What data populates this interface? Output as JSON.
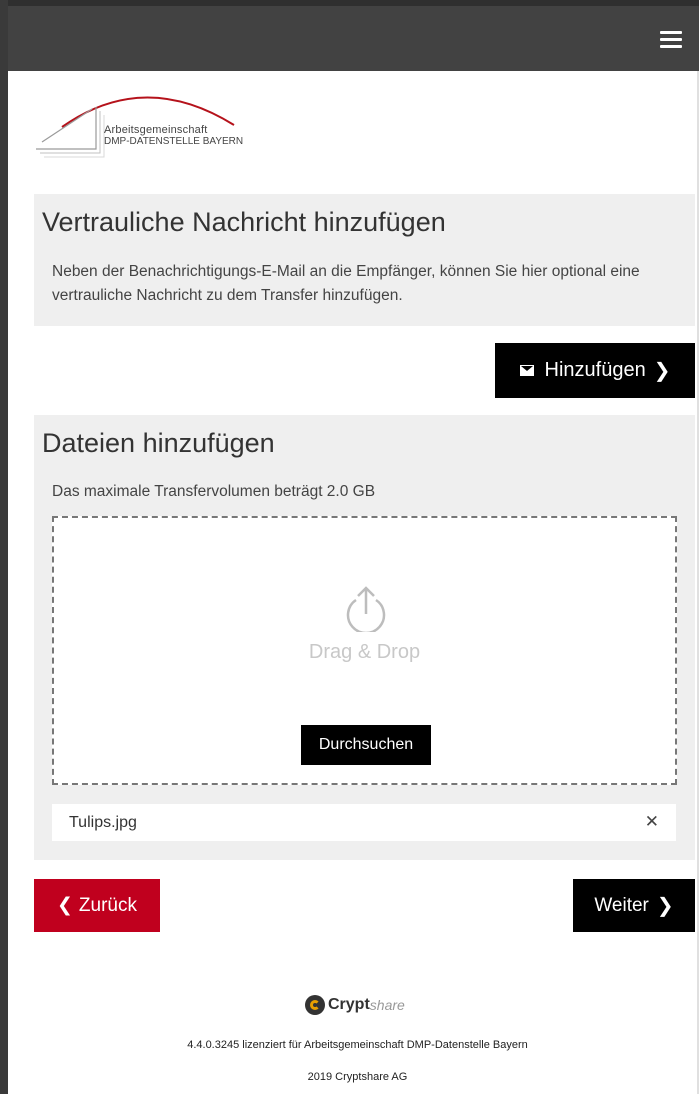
{
  "header": {
    "menu_icon": "hamburger-menu-icon"
  },
  "logo": {
    "line1": "Arbeitsgemeinschaft",
    "line2": "DMP-DATENSTELLE BAYERN",
    "accent_color": "#b5121b"
  },
  "message_section": {
    "title": "Vertrauliche Nachricht hinzufügen",
    "description": "Neben der Benachrichtigungs-E-Mail an die Empfänger, können Sie hier optional eine vertrauliche Nachricht zu dem Transfer hinzufügen.",
    "add_button_label": "Hinzufügen"
  },
  "files_section": {
    "title": "Dateien hinzufügen",
    "limit_text": "Das maximale Transfervolumen beträgt 2.0 GB",
    "drop_text": "Drag & Drop",
    "browse_label": "Durchsuchen",
    "files": [
      {
        "name": "Tulips.jpg"
      }
    ]
  },
  "navigation": {
    "back_label": "Zurück",
    "next_label": "Weiter",
    "back_color": "#c0001e"
  },
  "footer": {
    "brand_bold": "Crypt",
    "brand_light": "share",
    "license": "4.4.0.3245 lizenziert für Arbeitsgemeinschaft DMP-Datenstelle Bayern",
    "copyright": "2019 Cryptshare AG"
  }
}
